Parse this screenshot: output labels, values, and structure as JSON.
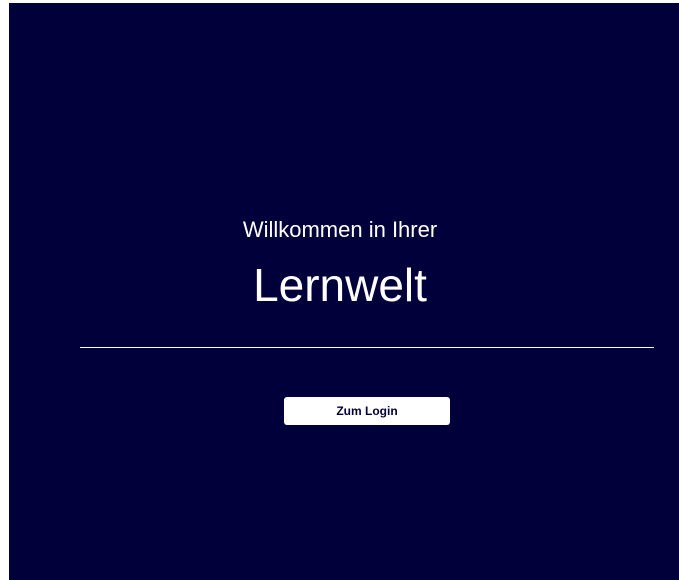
{
  "welcome": {
    "subtitle": "Willkommen in Ihrer",
    "title": "Lernwelt"
  },
  "actions": {
    "login_label": "Zum Login"
  },
  "colors": {
    "background": "#01003a",
    "text": "#ffffff",
    "button_background": "#ffffff",
    "button_text": "#01003a"
  }
}
